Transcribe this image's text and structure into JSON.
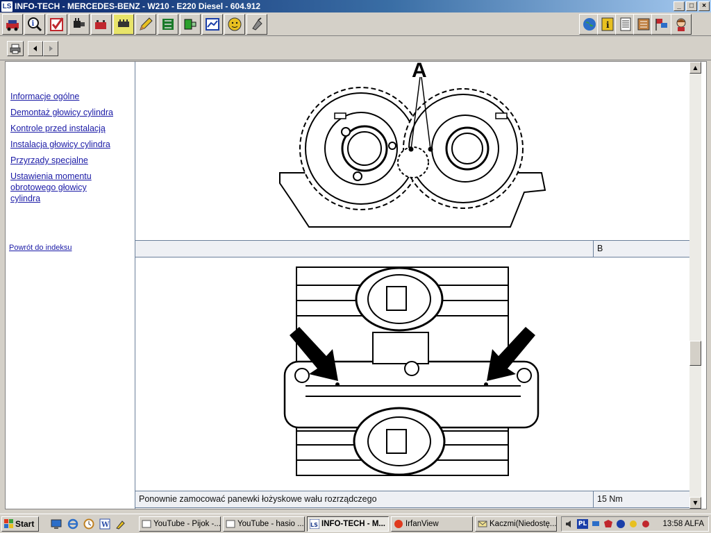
{
  "window": {
    "logo": "LS",
    "title": "INFO-TECH - MERCEDES-BENZ - W210 - E220 Diesel - 604.912",
    "controls": [
      "_",
      "□",
      "×"
    ]
  },
  "toolbar": {
    "left_icons": [
      "car-icon",
      "info-search-icon",
      "checklist-icon",
      "gearbox-icon",
      "battery-icon",
      "wiring-icon",
      "pencil-icon",
      "circuit-icon",
      "schematic-icon",
      "diagram-icon",
      "face-icon",
      "plug-icon"
    ],
    "right_icons": [
      "globe-icon",
      "info-icon",
      "notebook-icon",
      "list-icon",
      "flags-icon",
      "help-person-icon"
    ]
  },
  "navbar": {
    "print_icon": "printer-icon",
    "back_icon": "back-arrow-icon",
    "forward_icon": "forward-arrow-icon"
  },
  "sidebar": {
    "links": [
      "Informacje ogólne",
      "Demontaż głowicy cylindra",
      "Kontrole przed instalacją",
      "Instalacja głowicy cylindra",
      "Przyrządy specjalne",
      "Ustawienia momentu ",
      "obrotowego głowicy ",
      "cylindra"
    ],
    "back_link": "Powrót do indeksu"
  },
  "main": {
    "figure_top_label": "A",
    "rows": [
      {
        "desc": "",
        "value": "B"
      },
      {
        "desc": "Ponownie zamocować panewki łożyskowe wału rozrządczego",
        "value": "15 Nm"
      }
    ]
  },
  "taskbar": {
    "start_label": "Start",
    "quicklaunch": [
      "desktop-icon",
      "ie-icon",
      "clock-icon",
      "word-icon",
      "tool-icon"
    ],
    "tasks": [
      {
        "label": "YouTube - Pijok -...",
        "active": false
      },
      {
        "label": "YouTube - hasio ...",
        "active": false
      },
      {
        "label": "INFO-TECH - M...",
        "active": true
      },
      {
        "label": "IrfanView",
        "active": false
      },
      {
        "label": "Kaczmi(Niedostę...",
        "active": false
      }
    ],
    "tray": {
      "language": "PL",
      "clock": "13:58 ALFA"
    }
  },
  "colors": {
    "title_start": "#0a246a",
    "title_end": "#a6caf0",
    "link": "#1a1aa6",
    "table_border": "#6a7f9a",
    "toolbar_active": "#e8e46a"
  }
}
